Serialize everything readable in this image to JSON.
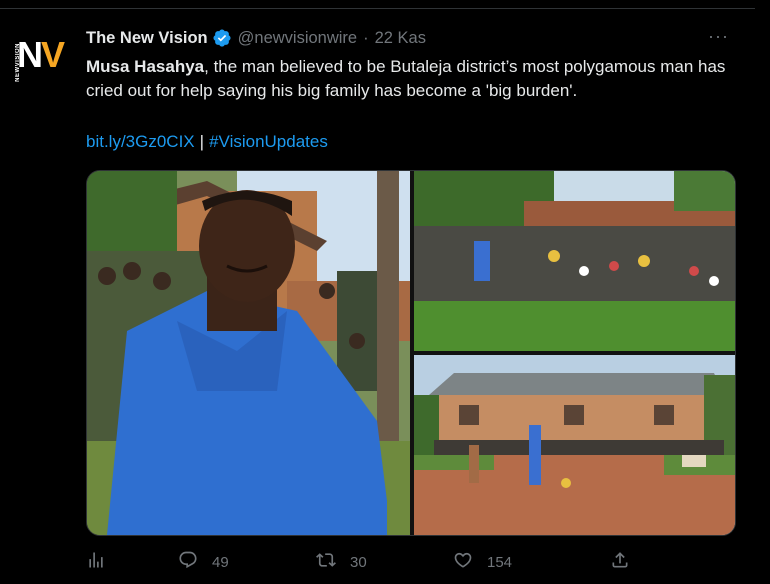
{
  "account": {
    "display_name": "The New Vision",
    "handle": "@newvisionwire",
    "dot": "·",
    "date": "22 Kas",
    "logo_text": "N",
    "logo_accent": "V",
    "logo_small": "NEWVISION"
  },
  "tweet": {
    "bold_name": "Musa Hasahya",
    "body": ", the man believed to be Butaleja district’s most polygamous man has cried out for help saying his big family has become a 'big burden'.",
    "link": "bit.ly/3Gz0CIX",
    "separator": "|",
    "hashtag": "#VisionUpdates"
  },
  "media": {
    "photos": [
      {
        "name": "man-in-blue-shirt-photo"
      },
      {
        "name": "large-family-group-photo"
      },
      {
        "name": "family-house-photo"
      }
    ]
  },
  "actions": {
    "views_icon": "bar-chart-icon",
    "reply_icon": "reply-icon",
    "reply_count": "49",
    "retweet_icon": "retweet-icon",
    "retweet_count": "30",
    "like_icon": "heart-icon",
    "like_count": "154",
    "share_icon": "share-icon"
  },
  "colors": {
    "background": "#000000",
    "text": "#e7e9ea",
    "muted": "#71767b",
    "link": "#1d9bf0",
    "verified": "#1d9bf0",
    "logo_accent": "#f5a623"
  }
}
